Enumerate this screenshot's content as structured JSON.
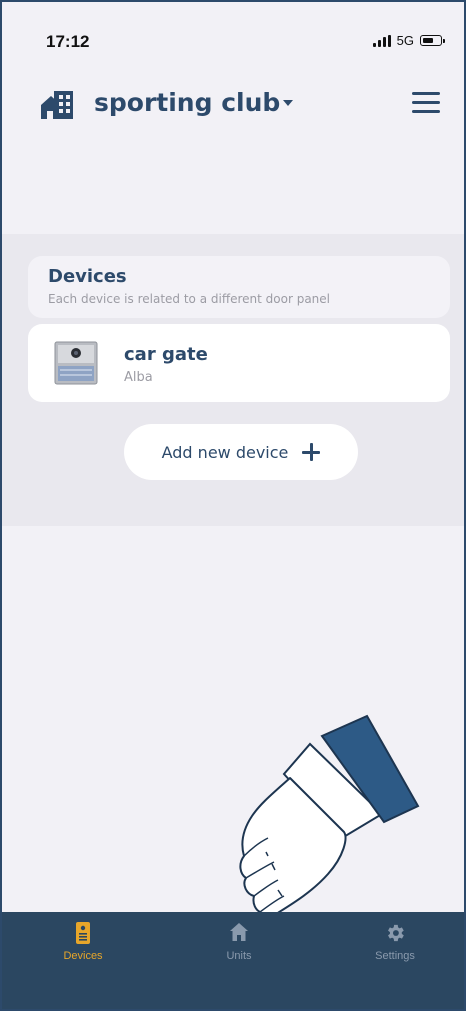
{
  "status_bar": {
    "time": "17:12",
    "network": "5G"
  },
  "header": {
    "site_name": "sporting club",
    "icons": [
      "building-icon",
      "caret-down-icon",
      "menu-icon"
    ]
  },
  "devices_section": {
    "title": "Devices",
    "subtitle": "Each device is related to a different door panel",
    "items": [
      {
        "name": "car gate",
        "model": "Alba",
        "icon": "door-panel-image"
      }
    ],
    "add_button_label": "Add new device"
  },
  "tab_bar": {
    "tabs": [
      {
        "label": "Devices",
        "icon": "door-panel-icon",
        "active": true
      },
      {
        "label": "Units",
        "icon": "home-icon",
        "active": false
      },
      {
        "label": "Settings",
        "icon": "gear-icon",
        "active": false
      }
    ]
  },
  "colors": {
    "primary": "#2d4a6b",
    "tab_bar": "#2b4761",
    "tab_active": "#e7a62a",
    "tab_inactive": "#8a9aad",
    "background": "#f2f1f6",
    "subtitle": "#9c9ca4"
  }
}
